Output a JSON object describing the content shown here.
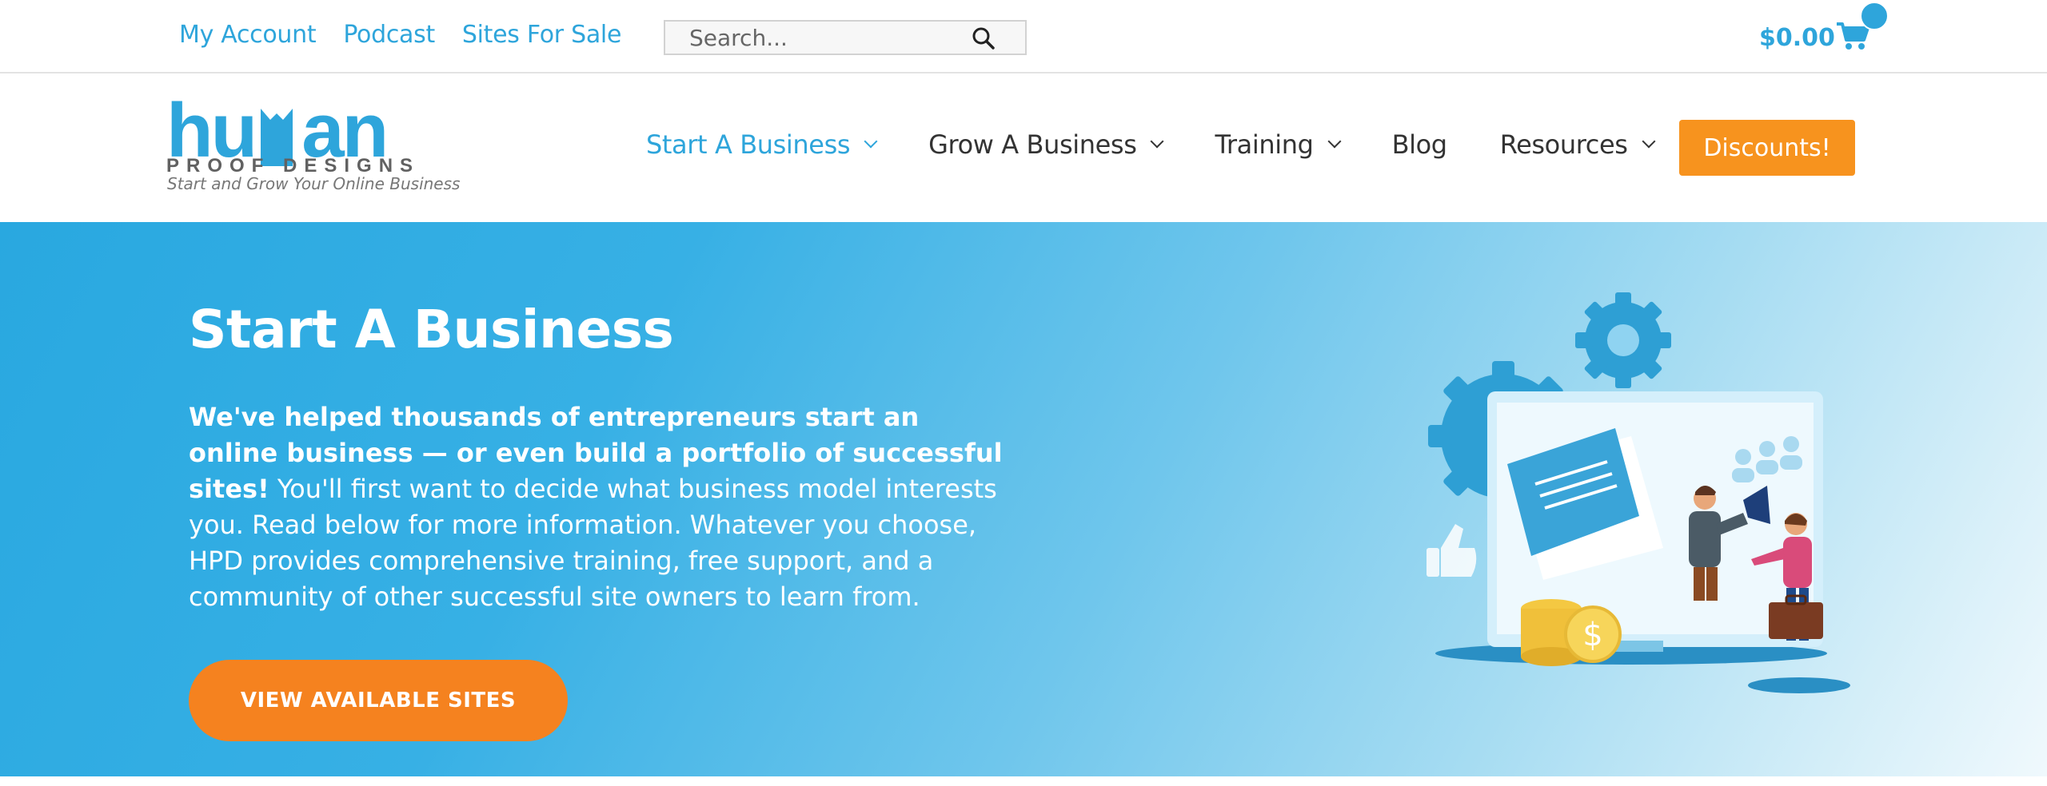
{
  "topbar": {
    "links": [
      "My Account",
      "Podcast",
      "Sites For Sale"
    ],
    "search_placeholder": "Search...",
    "search_icon": "search-icon",
    "cart_total": "$0.00",
    "cart_icon": "cart-icon"
  },
  "header": {
    "logo_text": "human",
    "logo_subtext": "PROOF DESIGNS",
    "tagline": "Start and Grow Your Online Business",
    "nav": [
      {
        "label": "Start A Business",
        "active": true,
        "dropdown": true
      },
      {
        "label": "Grow A Business",
        "active": false,
        "dropdown": true
      },
      {
        "label": "Training",
        "active": false,
        "dropdown": true
      },
      {
        "label": "Blog",
        "active": false,
        "dropdown": false
      },
      {
        "label": "Resources",
        "active": false,
        "dropdown": true
      }
    ],
    "discounts_label": "Discounts!"
  },
  "hero": {
    "title": "Start A Business",
    "intro_bold": "We've helped thousands of entrepreneurs start an online business — or even build a portfolio of successful sites!",
    "intro_rest": "  You'll first want to decide what business model interests you.  Read below for more information.  Whatever you choose, HPD provides comprehensive training, free support, and a community of other successful site owners to learn from.",
    "cta_label": "VIEW AVAILABLE SITES"
  },
  "colors": {
    "accent_blue": "#2ea5db",
    "orange": "#f7931e",
    "cta_orange": "#f5821f"
  }
}
